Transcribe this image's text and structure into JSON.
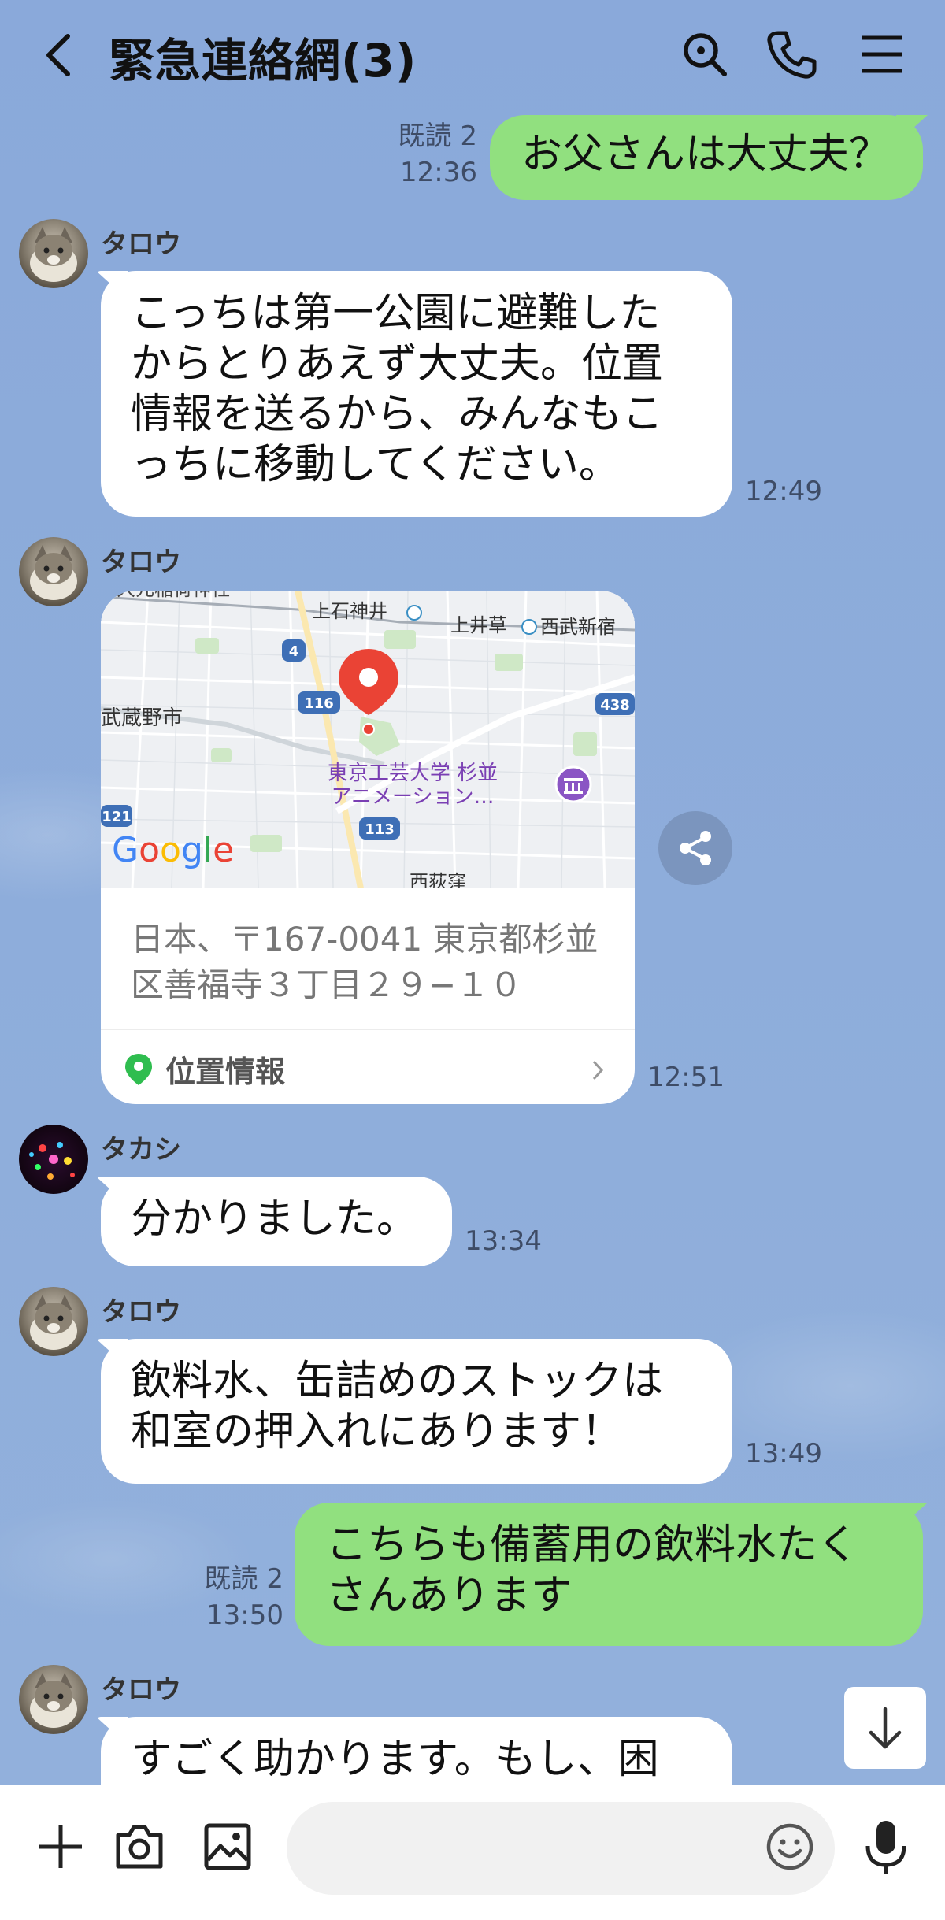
{
  "header": {
    "title": "緊急連絡網(3)"
  },
  "messages": {
    "m1": {
      "read": "既読 2",
      "time": "12:36",
      "text": "お父さんは大丈夫？"
    },
    "m2": {
      "sender": "タロウ",
      "lines": [
        "こっちは第一公園に避難した",
        "からとりあえず大丈夫。位置",
        "情報を送るから、みんなもこ",
        "っちに移動してください。"
      ],
      "time": "12:49"
    },
    "m3": {
      "sender": "タロウ",
      "map_labels": {
        "shrine": "大元稲荷神社",
        "station1": "上石神井",
        "station2": "上井草",
        "line": "西武新宿",
        "city": "武蔵野市",
        "route4": "4",
        "route116": "116",
        "route438": "438",
        "route121": "121",
        "route113": "113",
        "poi_line1": "東京工芸大学 杉並",
        "poi_line2": "アニメーション…",
        "google": "Google",
        "bottom": "西荻窪"
      },
      "address_lines": [
        "日本、〒167-0041 東京都杉並",
        "区善福寺３丁目２９−１０"
      ],
      "location_label": "位置情報",
      "time": "12:51"
    },
    "m4": {
      "sender": "タカシ",
      "text": "分かりました。",
      "time": "13:34"
    },
    "m5": {
      "sender": "タロウ",
      "lines": [
        "飲料水、缶詰めのストックは",
        "和室の押入れにあります！"
      ],
      "time": "13:49"
    },
    "m6": {
      "read": "既読 2",
      "time": "13:50",
      "lines": [
        "こちらも備蓄用の飲料水たく",
        "さんあります"
      ]
    },
    "m7": {
      "sender": "タロウ",
      "text": "すごく助かります。もし、困"
    }
  },
  "input": {
    "placeholder": ""
  },
  "colors": {
    "background": "#8dabda",
    "green_bubble": "#91e07f",
    "white_bubble": "#ffffff",
    "pin": "#ea4335"
  }
}
